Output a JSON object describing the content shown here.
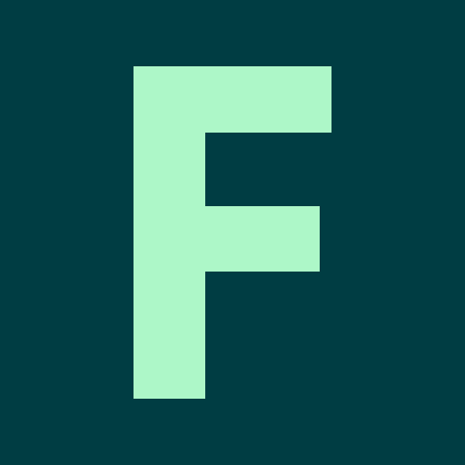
{
  "icon": {
    "letter": "F",
    "background_color": "#003D43",
    "letter_color": "#ADF7C8"
  }
}
